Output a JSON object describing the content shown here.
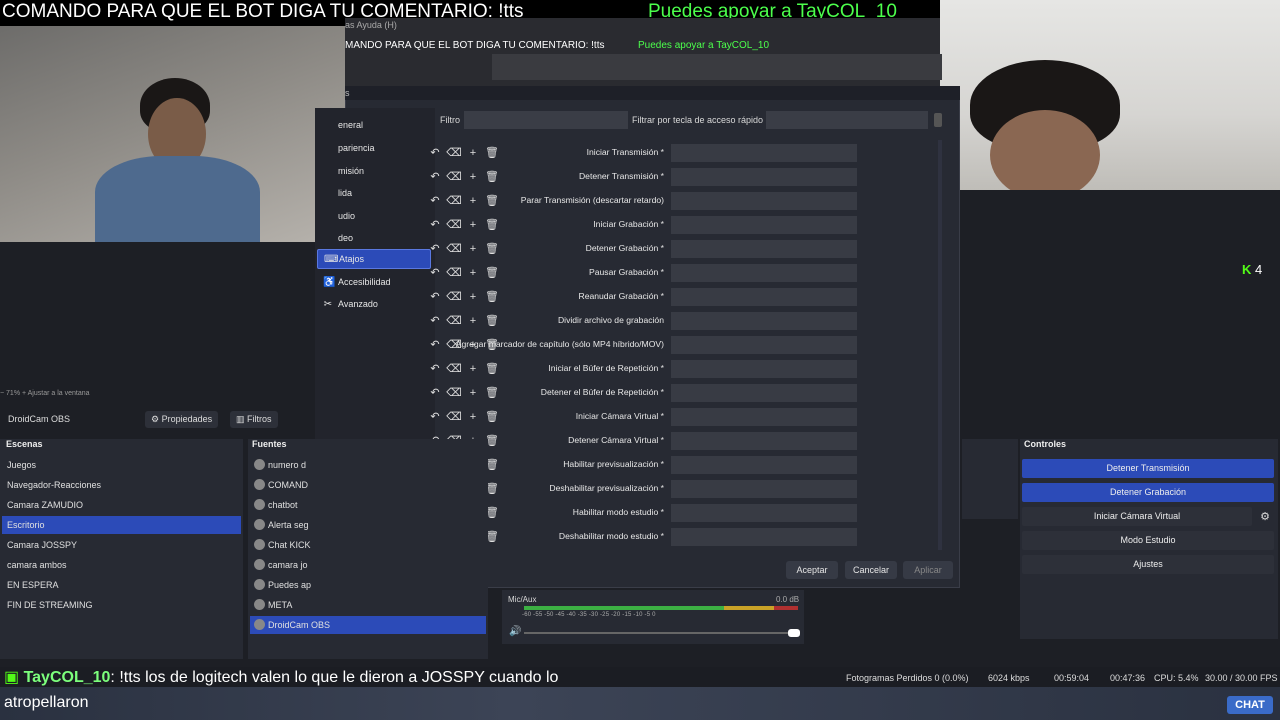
{
  "overlay": {
    "command_text": "COMANDO PARA QUE EL BOT DIGA TU COMENTARIO: !tts",
    "support_text": "Puedes apoyar a TayCOL_10",
    "preview_command_text": "MANDO PARA QUE EL BOT DIGA TU COMENTARIO: !tts",
    "preview_support_text": "Puedes apoyar a TayCOL_10",
    "preview_menu": "as   Ayuda (H)"
  },
  "dialog": {
    "title_fragment": "s",
    "nav": [
      {
        "label": "eneral",
        "icon": "gear-icon",
        "glyph": ""
      },
      {
        "label": "pariencia",
        "icon": "palette-icon",
        "glyph": ""
      },
      {
        "label": "misión",
        "icon": "broadcast-icon",
        "glyph": ""
      },
      {
        "label": "lida",
        "icon": "output-icon",
        "glyph": ""
      },
      {
        "label": "udio",
        "icon": "audio-icon",
        "glyph": ""
      },
      {
        "label": "deo",
        "icon": "video-icon",
        "glyph": ""
      },
      {
        "label": "Atajos",
        "icon": "keyboard-icon",
        "glyph": "⌨",
        "selected": true
      },
      {
        "label": "Accesibilidad",
        "icon": "accessibility-icon",
        "glyph": "♿"
      },
      {
        "label": "Avanzado",
        "icon": "wrench-icon",
        "glyph": "✂"
      }
    ],
    "filter_label": "Filtro",
    "filter_value": "",
    "filter_key_label": "Filtrar por tecla de acceso rápido",
    "filter_key_value": "",
    "hotkeys": [
      "Iniciar Transmisión *",
      "Detener Transmisión *",
      "Parar Transmisión (descartar retardo)",
      "Iniciar Grabación *",
      "Detener Grabación *",
      "Pausar Grabación *",
      "Reanudar Grabación *",
      "Dividir archivo de grabación",
      "Agregar marcador de capítulo (sólo MP4 híbrido/MOV)",
      "Iniciar el Búfer de Repetición *",
      "Detener el Búfer de Repetición *",
      "Iniciar Cámara Virtual *",
      "Detener Cámara Virtual *",
      "Habilitar previsualización *",
      "Deshabilitar previsualización *",
      "Habilitar modo estudio *",
      "Deshabilitar modo estudio *"
    ],
    "buttons": {
      "accept": "Aceptar",
      "cancel": "Cancelar",
      "apply": "Aplicar"
    }
  },
  "main": {
    "zoom_text": "−   71%   +   Ajustar a la ventana",
    "source_name": "DroidCam OBS",
    "properties_label": "Propiedades",
    "filters_label": "Filtros",
    "scenes_title": "Escenas",
    "scenes": [
      "Juegos",
      "Navegador-Reacciones",
      "Camara ZAMUDIO",
      "Escritorio",
      "Camara JOSSPY",
      "camara ambos",
      "EN ESPERA",
      "FIN DE STREAMING"
    ],
    "selected_scene": 3,
    "sources_title": "Fuentes",
    "sources": [
      "numero d",
      "COMAND",
      "chatbot",
      "Alerta seg",
      "Chat KICK",
      "camara jo",
      "Puedes ap",
      "META",
      "DroidCam OBS"
    ],
    "selected_source": 8,
    "mixer": {
      "label": "Mic/Aux",
      "db": "0.0 dB",
      "ticks": "-60  -55  -50  -45  -40  -35  -30  -25  -20  -15  -10   -5    0",
      "volume": 1.0
    },
    "controls_title": "Controles",
    "controls": [
      "Detener Transmisión",
      "Detener Grabación",
      "Iniciar Cámara Virtual",
      "Modo Estudio",
      "Ajustes"
    ]
  },
  "status": {
    "dropped": "Fotogramas Perdidos 0 (0.0%)",
    "bitrate": "6024 kbps",
    "stream_time": "00:59:04",
    "rec_time": "00:47:36",
    "cpu": "CPU: 5.4%",
    "fps": "30.00 / 30.00 FPS"
  },
  "chat": {
    "user": "TayCOL_10",
    "message": ": !tts los de logitech valen lo que le dieron a JOSSPY cuando lo",
    "message_line2": "atropellaron",
    "button": "CHAT"
  },
  "kick": {
    "viewers": "4"
  },
  "colors": {
    "accent": "#2c4bb8",
    "support_green": "#4cff4c",
    "kick_green": "#53fc18"
  }
}
